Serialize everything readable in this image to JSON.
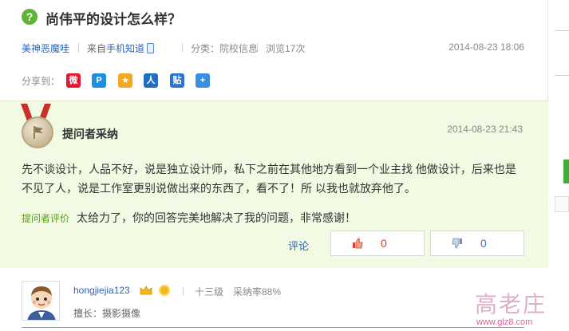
{
  "question": {
    "icon": "question-icon",
    "title": "尚伟平的设计怎么样？",
    "user": "美神恶魔哇",
    "from_prefix": "来自",
    "from_link": "手机知道",
    "category_prefix": "分类：",
    "category": "院校信息",
    "views": "浏览17次",
    "date": "2014-08-23 18:06",
    "share_label": "分享到：",
    "share_buttons": [
      {
        "icon": "weibo-icon",
        "glyph": "微",
        "color": "#e6162d"
      },
      {
        "icon": "qzone-icon",
        "glyph": "P",
        "color": "#1d8fde"
      },
      {
        "icon": "qq-weibo-icon",
        "glyph": "★",
        "color": "#f5a623"
      },
      {
        "icon": "renren-icon",
        "glyph": "人",
        "color": "#1d6fc6"
      },
      {
        "icon": "tieba-icon",
        "glyph": "贴",
        "color": "#2a75d1"
      },
      {
        "icon": "more-share-icon",
        "glyph": "+",
        "color": "#3a8fe0"
      }
    ]
  },
  "answer": {
    "best_label": "提问者采纳",
    "date": "2014-08-23 21:43",
    "text": "先不谈设计，人品不好，说是独立设计师，私下之前在其他地方看到一个业主找 他做设计，后来也是不见了人，说是工作室更别说做出来的东西了，看不了！所 以我也就放弃他了。",
    "eval_label": "提问者评价",
    "eval_text": "太给力了，你的回答完美地解决了我的问题，非常感谢！",
    "comment_label": "评论",
    "upvotes": "0",
    "downvotes": "0"
  },
  "answerer": {
    "username": "hongjiejia123",
    "level": "十三级",
    "accept_rate": "采纳率88%",
    "specialty_label": "擅长：",
    "specialty": "摄影摄像"
  },
  "watermark": {
    "title": "高老庄",
    "url": "www.glz8.com"
  },
  "colors": {
    "link": "#2d64b3",
    "answer_bg": "#f2fae4",
    "accent_green": "#5fb336",
    "upvote": "#d4422d",
    "downvote": "#3b74c7"
  }
}
